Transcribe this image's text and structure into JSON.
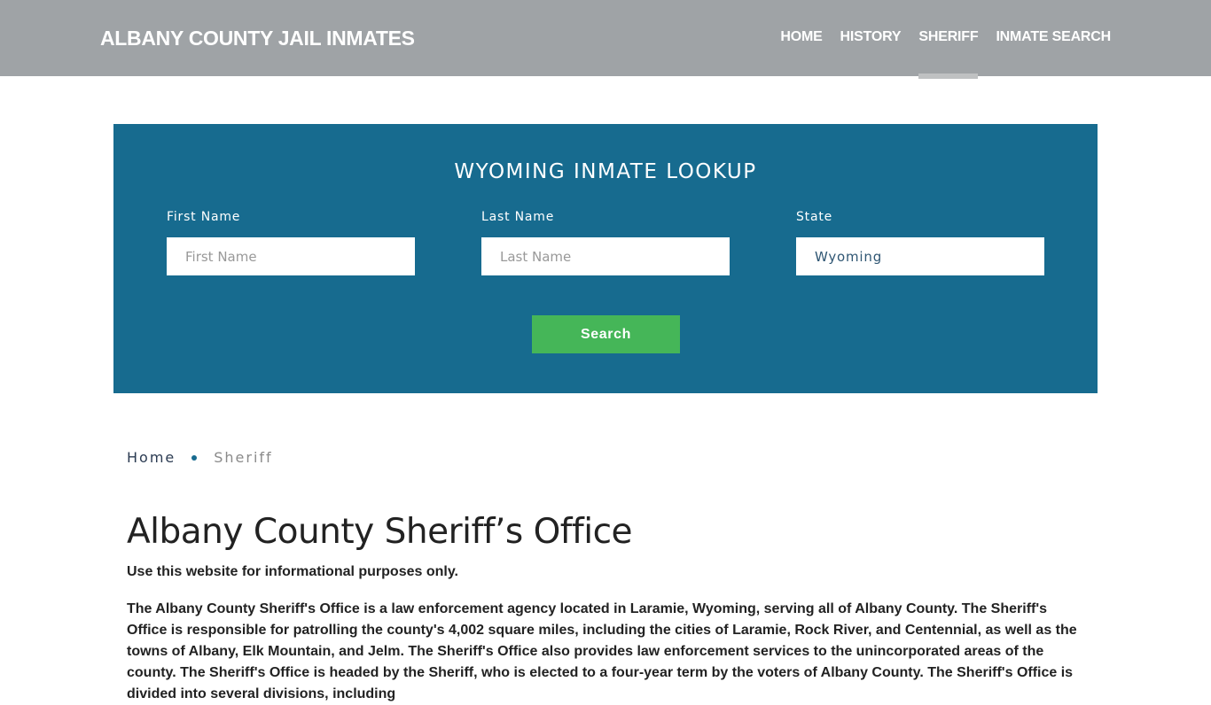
{
  "header": {
    "brand": "ALBANY COUNTY JAIL INMATES",
    "nav": [
      {
        "label": "HOME",
        "active": false
      },
      {
        "label": "HISTORY",
        "active": false
      },
      {
        "label": "SHERIFF",
        "active": true
      },
      {
        "label": "INMATE SEARCH",
        "active": false
      }
    ]
  },
  "lookup": {
    "title": "WYOMING INMATE LOOKUP",
    "first_name": {
      "label": "First Name",
      "placeholder": "First Name",
      "value": ""
    },
    "last_name": {
      "label": "Last Name",
      "placeholder": "Last Name",
      "value": ""
    },
    "state": {
      "label": "State",
      "value": "Wyoming"
    },
    "search_label": "Search"
  },
  "breadcrumb": {
    "home": "Home",
    "current": "Sheriff"
  },
  "content": {
    "title": "Albany County Sheriff’s Office",
    "note": "Use this website for informational purposes only.",
    "paragraph": "The Albany County Sheriff's Office is a law enforcement agency located in Laramie, Wyoming, serving all of Albany County. The Sheriff's Office is responsible for patrolling the county's 4,002 square miles, including the cities of Laramie, Rock River, and Centennial, as well as the towns of Albany, Elk Mountain, and Jelm. The Sheriff's Office also provides law enforcement services to the unincorporated areas of the county. The Sheriff's Office is headed by the Sheriff, who is elected to a four-year term by the voters of Albany County. The Sheriff's Office is divided into several divisions, including"
  },
  "colors": {
    "header_bg": "#9fa3a6",
    "lookup_bg": "#176b8f",
    "search_button": "#45b658",
    "active_underline": "#bfc1c2"
  }
}
